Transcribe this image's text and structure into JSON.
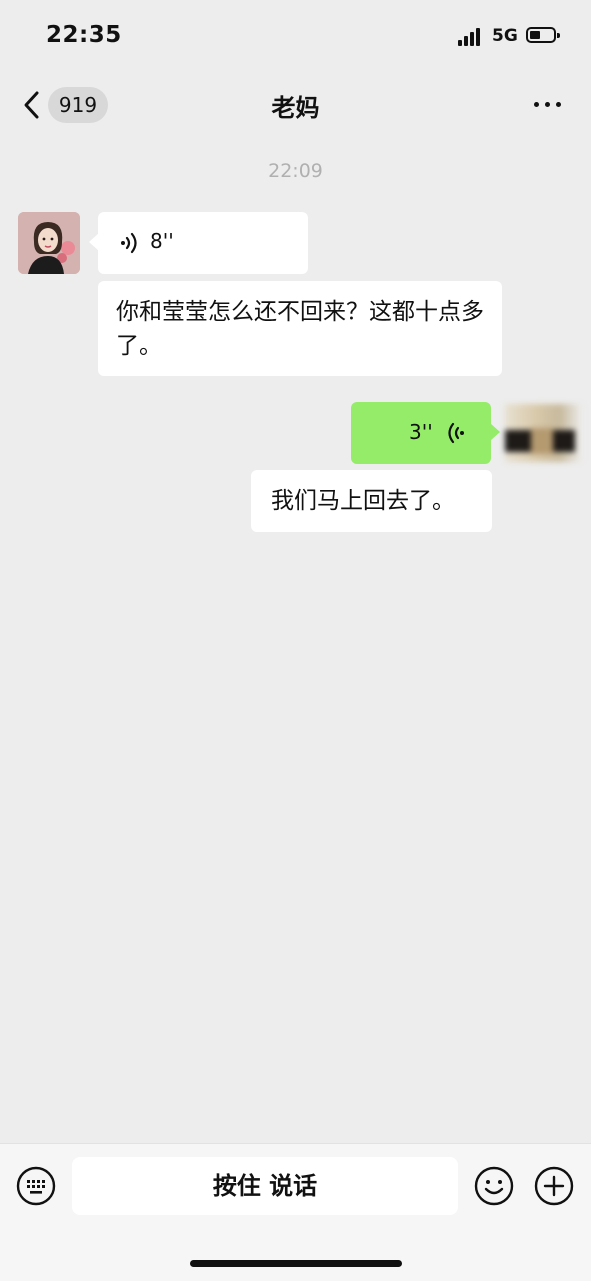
{
  "status_bar": {
    "time": "22:35",
    "network": "5G"
  },
  "nav": {
    "unread_count": "919",
    "title": "老妈"
  },
  "chat": {
    "timestamp": "22:09",
    "messages": [
      {
        "side": "left",
        "type": "voice",
        "duration": "8''"
      },
      {
        "side": "left",
        "type": "text",
        "text": "你和莹莹怎么还不回来？这都十点多了。"
      },
      {
        "side": "right",
        "type": "voice",
        "duration": "3''"
      },
      {
        "side": "right",
        "type": "text",
        "text": "我们马上回去了。"
      }
    ]
  },
  "input": {
    "hold_to_talk_label": "按住 说话"
  },
  "icons": {
    "back": "chevron-left-icon",
    "more": "more-dots-icon",
    "voice": "voice-wave-icon",
    "keyboard": "keyboard-icon",
    "emoji": "emoji-icon",
    "plus": "plus-icon"
  },
  "colors": {
    "background": "#ededed",
    "outgoing_bubble": "#95ec69",
    "incoming_bubble": "#ffffff"
  }
}
